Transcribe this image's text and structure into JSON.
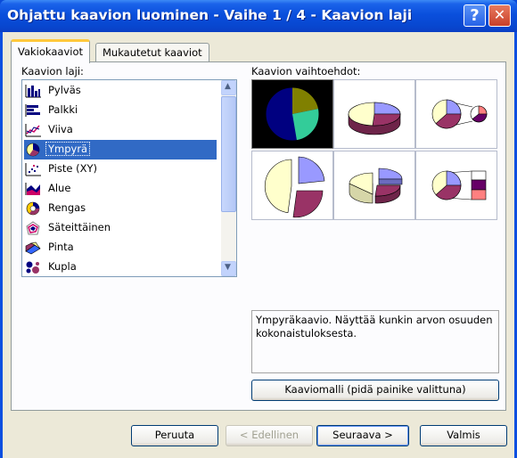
{
  "window": {
    "title": "Ohjattu kaavion luominen - Vaihe 1 / 4 - Kaavion laji"
  },
  "titlebar_buttons": {
    "help": "?",
    "close": "✕"
  },
  "tabs": [
    {
      "label": "Vakiokaaviot",
      "selected": true
    },
    {
      "label": "Mukautetut kaaviot",
      "selected": false
    }
  ],
  "chart_type_label": "Kaavion laji:",
  "chart_types": [
    {
      "label": "Pylväs",
      "icon": "column-chart-icon"
    },
    {
      "label": "Palkki",
      "icon": "bar-chart-icon"
    },
    {
      "label": "Viiva",
      "icon": "line-chart-icon"
    },
    {
      "label": "Ympyrä",
      "icon": "pie-chart-icon",
      "selected": true
    },
    {
      "label": "Piste (XY)",
      "icon": "scatter-chart-icon"
    },
    {
      "label": "Alue",
      "icon": "area-chart-icon"
    },
    {
      "label": "Rengas",
      "icon": "doughnut-chart-icon"
    },
    {
      "label": "Säteittäinen",
      "icon": "radar-chart-icon"
    },
    {
      "label": "Pinta",
      "icon": "surface-chart-icon"
    },
    {
      "label": "Kupla",
      "icon": "bubble-chart-icon"
    }
  ],
  "subtype_label": "Kaavion vaihtoehdot:",
  "subtypes": [
    {
      "icon": "pie-subtype-icon",
      "selected": true
    },
    {
      "icon": "pie-3d-subtype-icon"
    },
    {
      "icon": "pie-of-pie-subtype-icon"
    },
    {
      "icon": "exploded-pie-subtype-icon"
    },
    {
      "icon": "exploded-pie-3d-subtype-icon"
    },
    {
      "icon": "bar-of-pie-subtype-icon"
    }
  ],
  "description": "Ympyräkaavio. Näyttää kunkin arvon osuuden kokonaistuloksesta.",
  "preview_button": "Kaaviomalli (pidä painike valittuna)",
  "buttons": {
    "cancel": "Peruuta",
    "back": "< Edellinen",
    "next": "Seuraava >",
    "finish": "Valmis"
  },
  "colors": {
    "titlebar": "#0a4fdc",
    "selection": "#316ac5",
    "pie_periwinkle": "#9999ff",
    "pie_plum": "#993366",
    "pie_cream": "#ffffcc"
  }
}
